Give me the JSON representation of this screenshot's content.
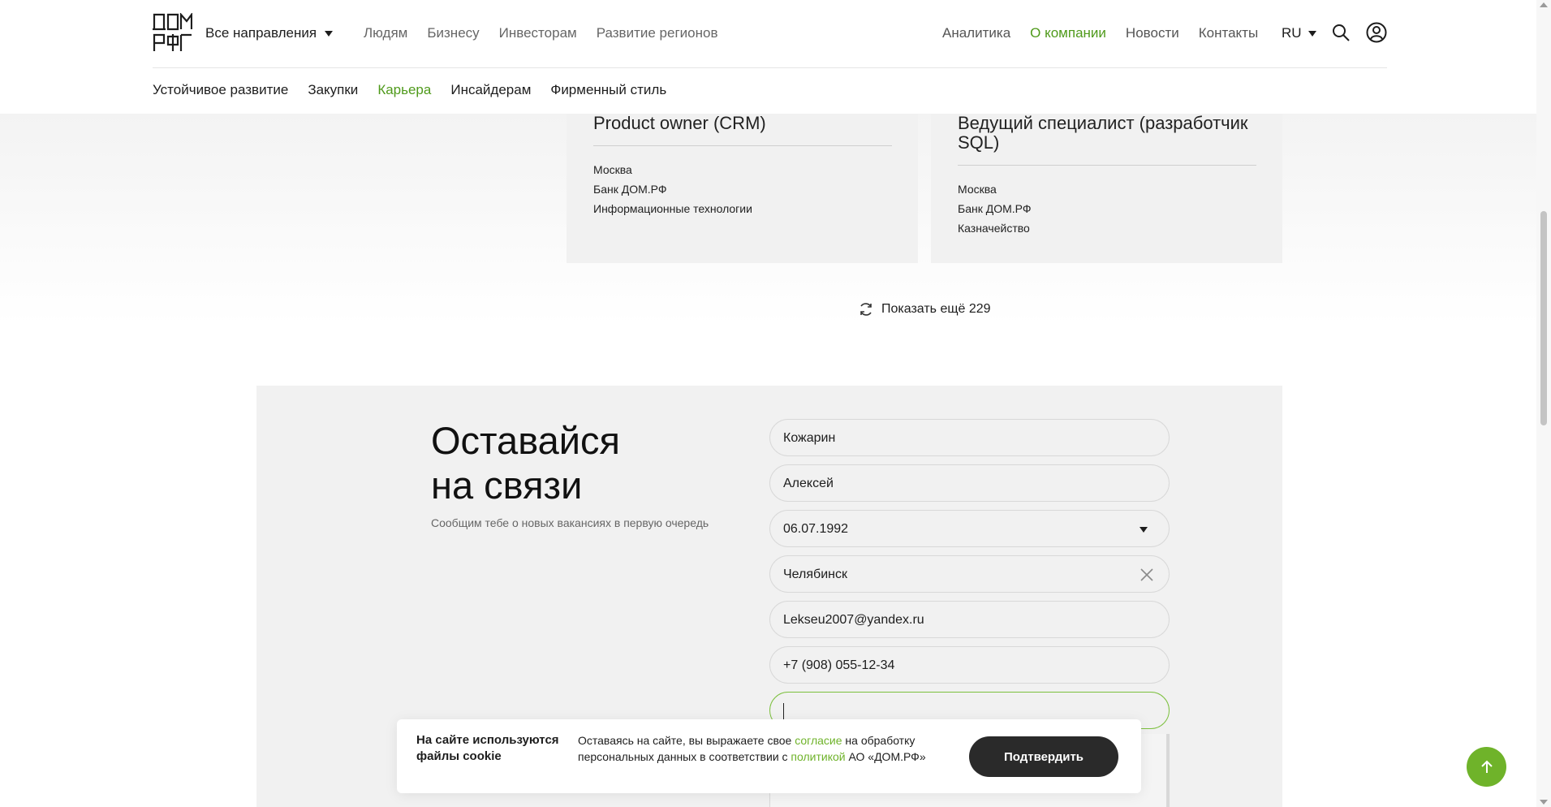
{
  "header": {
    "all_directions": "Все направления",
    "nav_main": [
      "Людям",
      "Бизнесу",
      "Инвесторам",
      "Развитие регионов"
    ],
    "nav_right": [
      "Аналитика",
      "О компании",
      "Новости",
      "Контакты"
    ],
    "nav_right_active": "О компании",
    "lang": "RU",
    "nav_sub": [
      "Устойчивое развитие",
      "Закупки",
      "Карьера",
      "Инсайдерам",
      "Фирменный стиль"
    ],
    "nav_sub_active": "Карьера"
  },
  "vacancies": [
    {
      "title": "Product owner (CRM)",
      "city": "Москва",
      "company": "Банк ДОМ.РФ",
      "department": "Информационные технологии"
    },
    {
      "title": "Ведущий специалист (разработчик SQL)",
      "city": "Москва",
      "company": "Банк ДОМ.РФ",
      "department": "Казначейство"
    }
  ],
  "show_more": "Показать ещё 229",
  "subscribe": {
    "title_line1": "Оставайся",
    "title_line2": "на связи",
    "subtitle": "Сообщим тебе о новых вакансиях в первую очередь",
    "fields": {
      "last_name": "Кожарин",
      "first_name": "Алексей",
      "birth_date": "06.07.1992",
      "city": "Челябинск",
      "email": "Lekseu2007@yandex.ru",
      "phone": "+7 (908) 055-12-34",
      "active_field": ""
    }
  },
  "cookie": {
    "title": "На сайте используются файлы cookie",
    "text_part1": "Оставаясь на сайте, вы выражаете свое ",
    "link1": "согласие",
    "text_part2": " на обработку персональных данных в соответствии с ",
    "link2": "политикой",
    "text_part3": " АО «ДОМ.РФ»",
    "button": "Подтвердить"
  },
  "colors": {
    "accent": "#6fb32a",
    "active_nav": "#4f9a1b",
    "dark_button": "#2a2a2a"
  }
}
